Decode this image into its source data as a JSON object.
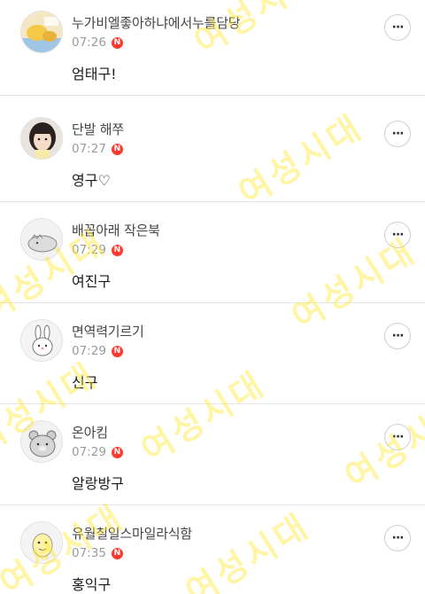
{
  "posts": [
    {
      "author": "누가비엘좋아하냐에서누를담당",
      "time": "07:26",
      "badge": "N",
      "comment": "엄태구!",
      "avatar_icon": "photo-avatar-icon"
    },
    {
      "author": "단발 해쭈",
      "time": "07:27",
      "badge": "N",
      "comment": "영구♡",
      "avatar_icon": "girl-photo-avatar-icon"
    },
    {
      "author": "배꼽아래 작은북",
      "time": "07:29",
      "badge": "N",
      "comment": "여진구",
      "avatar_icon": "dinosaur-avatar-icon"
    },
    {
      "author": "면역력기르기",
      "time": "07:29",
      "badge": "N",
      "comment": "신구",
      "avatar_icon": "rabbit-avatar-icon"
    },
    {
      "author": "온아킴",
      "time": "07:29",
      "badge": "N",
      "comment": "알랑방구",
      "avatar_icon": "bear-avatar-icon"
    },
    {
      "author": "유월칠일스마일라식함",
      "time": "07:35",
      "badge": "N",
      "comment": "홍익구",
      "avatar_icon": "character-avatar-icon"
    }
  ],
  "more_icon": "···",
  "watermark": "여성시대",
  "colors": {
    "badge": "#ff3b30",
    "watermark": "#ffe628",
    "divider": "#e6e6e6"
  }
}
